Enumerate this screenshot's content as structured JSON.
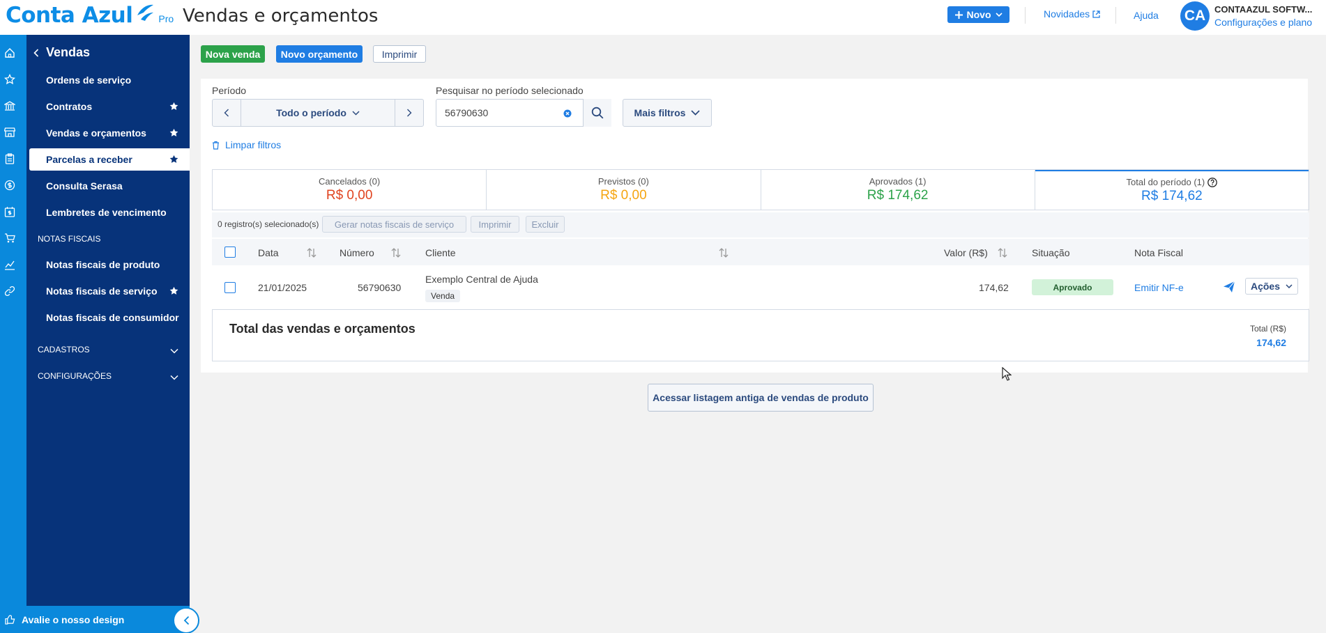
{
  "app": {
    "logo_text": "Conta Azul",
    "logo_badge": "Pro",
    "page_title": "Vendas e orçamentos",
    "new_button": "Novo",
    "news_link": "Novidades",
    "help_link": "Ajuda",
    "avatar_initials": "CA",
    "company_name": "CONTAAZUL SOFTW...",
    "config_link": "Configurações e plano"
  },
  "colors": {
    "brand": "#0a89dc",
    "sidebar": "#07337a",
    "green": "#2ca24a",
    "blue": "#1f7de3",
    "red": "#e0431f",
    "orange": "#f5a511"
  },
  "rail_icons": [
    "home-icon",
    "star-icon",
    "bank-icon",
    "store-icon",
    "clipboard-icon",
    "dollar-icon",
    "calendar-dollar-icon",
    "cart-icon",
    "chart-icon",
    "link-icon"
  ],
  "sidebar": {
    "header": "Vendas",
    "items": [
      {
        "label": "Ordens de serviço",
        "starred": false
      },
      {
        "label": "Contratos",
        "starred": true
      },
      {
        "label": "Vendas e orçamentos",
        "starred": true
      },
      {
        "label": "Parcelas a receber",
        "starred": true,
        "active": true
      },
      {
        "label": "Consulta Serasa",
        "starred": false
      },
      {
        "label": "Lembretes de vencimento",
        "starred": false
      }
    ],
    "section_notas": "NOTAS FISCAIS",
    "notas_items": [
      {
        "label": "Notas fiscais de produto",
        "starred": false
      },
      {
        "label": "Notas fiscais de serviço",
        "starred": true
      },
      {
        "label": "Notas fiscais de consumidor",
        "starred": false
      }
    ],
    "section_cadastros": "CADASTROS",
    "section_config": "CONFIGURAÇÕES",
    "footer": "Avalie o nosso design"
  },
  "actions": {
    "new_sale": "Nova venda",
    "new_quote": "Novo orçamento",
    "print": "Imprimir"
  },
  "filters": {
    "period_label": "Período",
    "period_value": "Todo o período",
    "search_label": "Pesquisar no período selecionado",
    "search_value": "56790630",
    "more_filters": "Mais filtros",
    "clear_filters": "Limpar filtros"
  },
  "summary": [
    {
      "label": "Cancelados (0)",
      "value": "R$ 0,00",
      "color": "#e0431f"
    },
    {
      "label": "Previstos (0)",
      "value": "R$ 0,00",
      "color": "#f5a511"
    },
    {
      "label": "Aprovados (1)",
      "value": "R$ 174,62",
      "color": "#2ca24a"
    },
    {
      "label": "Total do período (1)",
      "value": "R$ 174,62",
      "color": "#1f7de3"
    }
  ],
  "bulk": {
    "count": "0 registro(s) selecionado(s)",
    "gen_invoices": "Gerar notas fiscais de serviço",
    "print": "Imprimir",
    "delete": "Excluir"
  },
  "table": {
    "columns": [
      "Data",
      "Número",
      "Cliente",
      "Valor (R$)",
      "Situação",
      "Nota Fiscal"
    ],
    "rows": [
      {
        "date": "21/01/2025",
        "number": "56790630",
        "client": "Exemplo Central de Ajuda",
        "type": "Venda",
        "value": "174,62",
        "status": "Aprovado",
        "invoice_action": "Emitir NF-e",
        "actions": "Ações"
      }
    ]
  },
  "totals": {
    "title": "Total das vendas e orçamentos",
    "label": "Total (R$)",
    "value": "174,62"
  },
  "old_list_button": "Acessar listagem antiga de vendas de produto"
}
